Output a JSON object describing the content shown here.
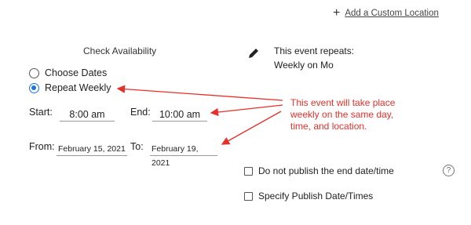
{
  "header": {
    "add_location_label": "Add a Custom Location",
    "add_icon": "plus-icon"
  },
  "availability": {
    "title": "Check Availability",
    "options": [
      {
        "label": "Choose Dates",
        "selected": false
      },
      {
        "label": "Repeat Weekly",
        "selected": true
      }
    ]
  },
  "repeat_summary": {
    "icon": "pencil-icon",
    "line1": "This event repeats:",
    "line2": "Weekly on Mo"
  },
  "time": {
    "start_label": "Start:",
    "start_value": "8:00 am",
    "end_label": "End:",
    "end_value": "10:00 am"
  },
  "dates": {
    "from_label": "From:",
    "from_value": "February 15, 2021",
    "to_label": "To:",
    "to_value": "February 19, 2021"
  },
  "annotation": {
    "text_line1": "This event will take place",
    "text_line2": "weekly on the same day,",
    "text_line3": "time, and location.",
    "color": "#e8302a"
  },
  "publish": {
    "no_end_date_label": "Do not publish the end date/time",
    "specify_label": "Specify Publish Date/Times",
    "help_icon": "question-circle-icon",
    "help_glyph": "?"
  },
  "accent_color": "#1a73e8"
}
